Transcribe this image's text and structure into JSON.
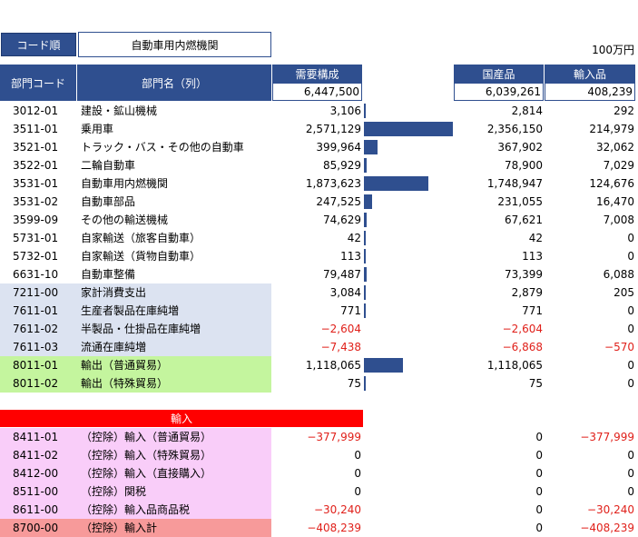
{
  "controls": {
    "sort_button": "コード順",
    "sector_select": "自動車用内燃機関",
    "unit": "100万円"
  },
  "headers": {
    "code": "部門コード",
    "name": "部門名（列）",
    "demand": "需要構成",
    "domestic": "国産品",
    "imported": "輸入品"
  },
  "totals": {
    "demand": "6,447,500",
    "domestic": "6,039,261",
    "imported": "408,239"
  },
  "colors": {
    "header_blue": "#2f4f8f",
    "final_demand_bg": "#dce3f1",
    "export_bg": "#c4f59e",
    "import_header_bg": "#ff0000",
    "import_rows_bg": "#f9cdf9",
    "import_total_bg": "#f79a9a",
    "negative_text": "#e0201a"
  },
  "import_section_label": "輸入",
  "rows": [
    {
      "code": "3012-01",
      "name": "建設・鉱山機械",
      "demand": "3,106",
      "domestic": "2,814",
      "imported": "292",
      "bar": 3106,
      "group": "intermediate"
    },
    {
      "code": "3511-01",
      "name": "乗用車",
      "demand": "2,571,129",
      "domestic": "2,356,150",
      "imported": "214,979",
      "bar": 2571129,
      "group": "intermediate"
    },
    {
      "code": "3521-01",
      "name": "トラック・バス・その他の自動車",
      "demand": "399,964",
      "domestic": "367,902",
      "imported": "32,062",
      "bar": 399964,
      "group": "intermediate"
    },
    {
      "code": "3522-01",
      "name": "二輪自動車",
      "demand": "85,929",
      "domestic": "78,900",
      "imported": "7,029",
      "bar": 85929,
      "group": "intermediate"
    },
    {
      "code": "3531-01",
      "name": "自動車用内燃機関",
      "demand": "1,873,623",
      "domestic": "1,748,947",
      "imported": "124,676",
      "bar": 1873623,
      "group": "intermediate"
    },
    {
      "code": "3531-02",
      "name": "自動車部品",
      "demand": "247,525",
      "domestic": "231,055",
      "imported": "16,470",
      "bar": 247525,
      "group": "intermediate"
    },
    {
      "code": "3599-09",
      "name": "その他の輸送機械",
      "demand": "74,629",
      "domestic": "67,621",
      "imported": "7,008",
      "bar": 74629,
      "group": "intermediate"
    },
    {
      "code": "5731-01",
      "name": "自家輸送（旅客自動車）",
      "demand": "42",
      "domestic": "42",
      "imported": "0",
      "bar": 42,
      "group": "intermediate"
    },
    {
      "code": "5732-01",
      "name": "自家輸送（貨物自動車）",
      "demand": "113",
      "domestic": "113",
      "imported": "0",
      "bar": 113,
      "group": "intermediate"
    },
    {
      "code": "6631-10",
      "name": "自動車整備",
      "demand": "79,487",
      "domestic": "73,399",
      "imported": "6,088",
      "bar": 79487,
      "group": "intermediate"
    },
    {
      "code": "7211-00",
      "name": "家計消費支出",
      "demand": "3,084",
      "domestic": "2,879",
      "imported": "205",
      "bar": 3084,
      "group": "final"
    },
    {
      "code": "7611-01",
      "name": "生産者製品在庫純増",
      "demand": "771",
      "domestic": "771",
      "imported": "0",
      "bar": 771,
      "group": "final"
    },
    {
      "code": "7611-02",
      "name": "半製品・仕掛品在庫純増",
      "demand": "−2,604",
      "domestic": "−2,604",
      "imported": "0",
      "bar": 0,
      "group": "final",
      "neg": [
        true,
        true,
        false
      ]
    },
    {
      "code": "7611-03",
      "name": "流通在庫純増",
      "demand": "−7,438",
      "domestic": "−6,868",
      "imported": "−570",
      "bar": 0,
      "group": "final",
      "neg": [
        true,
        true,
        true
      ]
    },
    {
      "code": "8011-01",
      "name": "輸出（普通貿易）",
      "demand": "1,118,065",
      "domestic": "1,118,065",
      "imported": "0",
      "bar": 1118065,
      "group": "export"
    },
    {
      "code": "8011-02",
      "name": "輸出（特殊貿易）",
      "demand": "75",
      "domestic": "75",
      "imported": "0",
      "bar": 75,
      "group": "export"
    }
  ],
  "import_rows": [
    {
      "code": "8411-01",
      "name": "（控除）輸入（普通貿易）",
      "demand": "−377,999",
      "domestic": "0",
      "imported": "−377,999",
      "neg": [
        true,
        false,
        true
      ],
      "group": "import"
    },
    {
      "code": "8411-02",
      "name": "（控除）輸入（特殊貿易）",
      "demand": "0",
      "domestic": "0",
      "imported": "0",
      "neg": [
        false,
        false,
        false
      ],
      "group": "import"
    },
    {
      "code": "8412-00",
      "name": "（控除）輸入（直接購入）",
      "demand": "0",
      "domestic": "0",
      "imported": "0",
      "neg": [
        false,
        false,
        false
      ],
      "group": "import"
    },
    {
      "code": "8511-00",
      "name": "（控除）関税",
      "demand": "0",
      "domestic": "0",
      "imported": "0",
      "neg": [
        false,
        false,
        false
      ],
      "group": "import"
    },
    {
      "code": "8611-00",
      "name": "（控除）輸入品商品税",
      "demand": "−30,240",
      "domestic": "0",
      "imported": "−30,240",
      "neg": [
        true,
        false,
        true
      ],
      "group": "import"
    },
    {
      "code": "8700-00",
      "name": "（控除）輸入計",
      "demand": "−408,239",
      "domestic": "0",
      "imported": "−408,239",
      "neg": [
        true,
        false,
        true
      ],
      "group": "import_total"
    }
  ]
}
